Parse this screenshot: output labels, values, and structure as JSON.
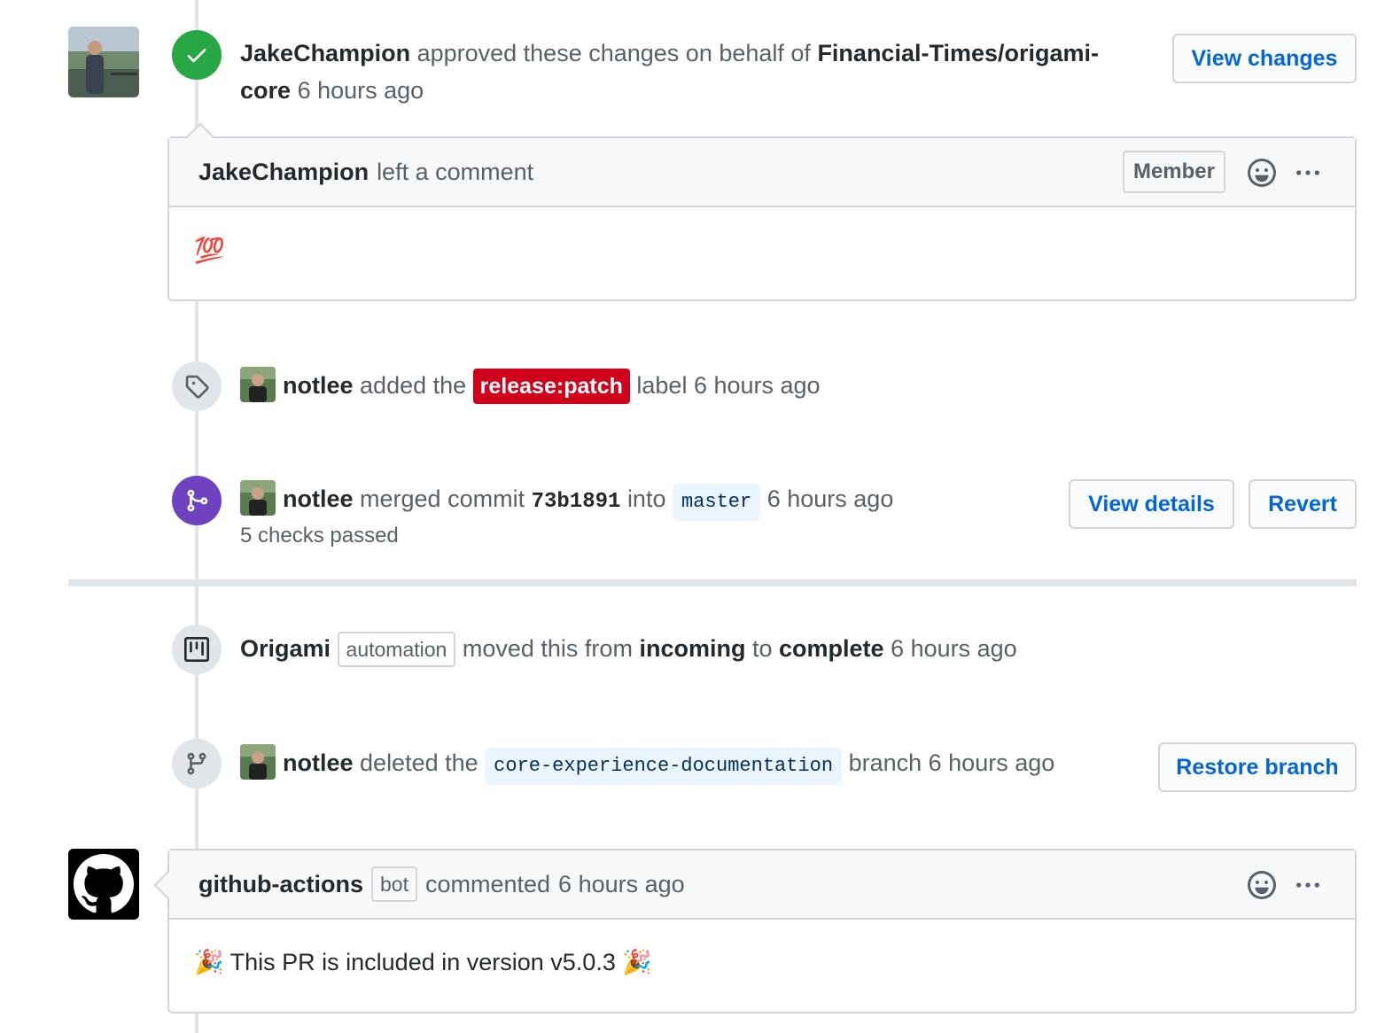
{
  "review": {
    "author": "JakeChampion",
    "action": "approved these changes on behalf of",
    "org": "Financial-Times/origami-",
    "org_cont": "core",
    "time": "6 hours ago",
    "view_changes": "View changes"
  },
  "comment1": {
    "author": "JakeChampion",
    "action": "left a comment",
    "member_label": "Member",
    "body": "💯"
  },
  "label_event": {
    "author": "notlee",
    "pre": "added the",
    "label": "release:patch",
    "post": "label",
    "time": "6 hours ago"
  },
  "merge_event": {
    "author": "notlee",
    "pre": "merged commit",
    "commit": "73b1891",
    "into": "into",
    "branch": "master",
    "time": "6 hours ago",
    "checks": "5 checks passed",
    "view_details": "View details",
    "revert": "Revert"
  },
  "project_event": {
    "author": "Origami",
    "tag": "automation",
    "pre": "moved this from",
    "from": "incoming",
    "to_word": "to",
    "to": "complete",
    "time": "6 hours ago"
  },
  "delete_event": {
    "author": "notlee",
    "pre": "deleted the",
    "branch": "core-experience-documentation",
    "post": "branch",
    "time": "6 hours ago",
    "restore": "Restore branch"
  },
  "comment2": {
    "author": "github-actions",
    "tag": "bot",
    "action": "commented",
    "time": "6 hours ago",
    "body": "🎉 This PR is included in version v5.0.3 🎉"
  },
  "colors": {
    "link": "#0366d6",
    "approved": "#28a745",
    "merged": "#6f42c1",
    "label": "#d0021b"
  }
}
